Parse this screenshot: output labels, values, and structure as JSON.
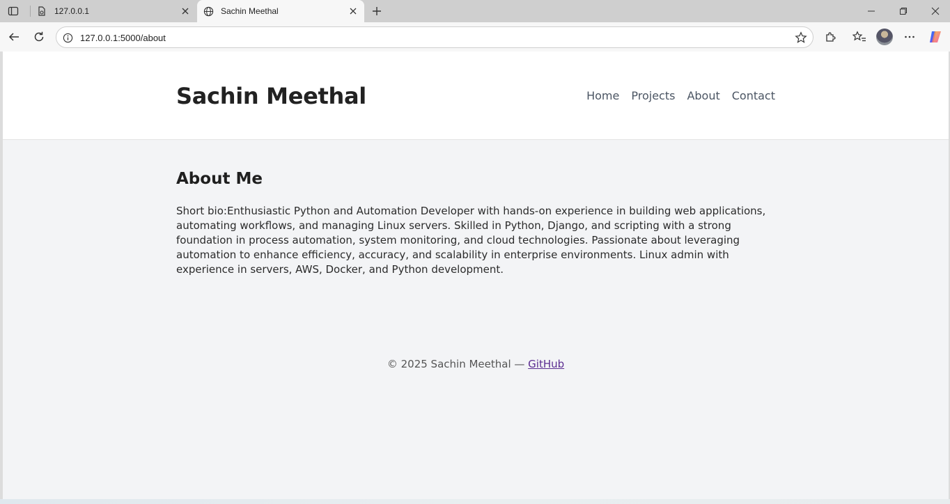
{
  "browser": {
    "tabs": [
      {
        "title": "127.0.0.1",
        "active": false
      },
      {
        "title": "Sachin Meethal",
        "active": true
      }
    ],
    "address": "127.0.0.1:5000/about"
  },
  "site": {
    "brand": "Sachin Meethal",
    "nav": [
      "Home",
      "Projects",
      "About",
      "Contact"
    ],
    "heading": "About Me",
    "bio": "Short bio:Enthusiastic Python and Automation Developer with hands-on experience in building web applications, automating workflows, and managing Linux servers. Skilled in Python, Django, and scripting with a strong foundation in process automation, system monitoring, and cloud technologies. Passionate about leveraging automation to enhance efficiency, accuracy, and scalability in enterprise environments. Linux admin with experience in servers, AWS, Docker, and Python development.",
    "footer_text": "© 2025 Sachin Meethal — ",
    "footer_link": "GitHub"
  },
  "colors": {
    "page_bg": "#f3f4f6",
    "header_bg": "#ffffff",
    "link_visited": "#5b2c91"
  }
}
